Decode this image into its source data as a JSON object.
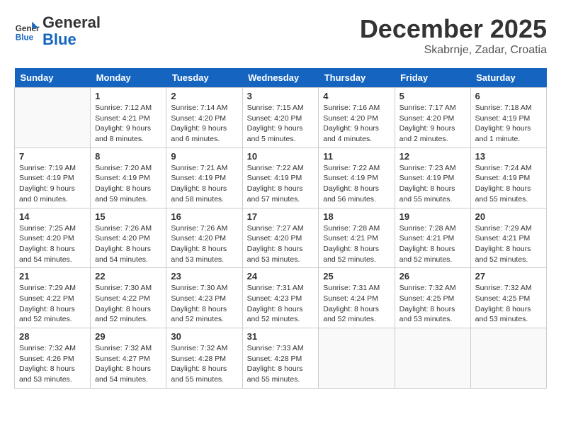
{
  "header": {
    "logo_general": "General",
    "logo_blue": "Blue",
    "month": "December 2025",
    "location": "Skabrnje, Zadar, Croatia"
  },
  "days_of_week": [
    "Sunday",
    "Monday",
    "Tuesday",
    "Wednesday",
    "Thursday",
    "Friday",
    "Saturday"
  ],
  "weeks": [
    [
      {
        "day": null
      },
      {
        "day": "1",
        "sunrise": "7:12 AM",
        "sunset": "4:21 PM",
        "daylight": "9 hours and 8 minutes."
      },
      {
        "day": "2",
        "sunrise": "7:14 AM",
        "sunset": "4:20 PM",
        "daylight": "9 hours and 6 minutes."
      },
      {
        "day": "3",
        "sunrise": "7:15 AM",
        "sunset": "4:20 PM",
        "daylight": "9 hours and 5 minutes."
      },
      {
        "day": "4",
        "sunrise": "7:16 AM",
        "sunset": "4:20 PM",
        "daylight": "9 hours and 4 minutes."
      },
      {
        "day": "5",
        "sunrise": "7:17 AM",
        "sunset": "4:20 PM",
        "daylight": "9 hours and 2 minutes."
      },
      {
        "day": "6",
        "sunrise": "7:18 AM",
        "sunset": "4:19 PM",
        "daylight": "9 hours and 1 minute."
      }
    ],
    [
      {
        "day": "7",
        "sunrise": "7:19 AM",
        "sunset": "4:19 PM",
        "daylight": "9 hours and 0 minutes."
      },
      {
        "day": "8",
        "sunrise": "7:20 AM",
        "sunset": "4:19 PM",
        "daylight": "8 hours and 59 minutes."
      },
      {
        "day": "9",
        "sunrise": "7:21 AM",
        "sunset": "4:19 PM",
        "daylight": "8 hours and 58 minutes."
      },
      {
        "day": "10",
        "sunrise": "7:22 AM",
        "sunset": "4:19 PM",
        "daylight": "8 hours and 57 minutes."
      },
      {
        "day": "11",
        "sunrise": "7:22 AM",
        "sunset": "4:19 PM",
        "daylight": "8 hours and 56 minutes."
      },
      {
        "day": "12",
        "sunrise": "7:23 AM",
        "sunset": "4:19 PM",
        "daylight": "8 hours and 55 minutes."
      },
      {
        "day": "13",
        "sunrise": "7:24 AM",
        "sunset": "4:19 PM",
        "daylight": "8 hours and 55 minutes."
      }
    ],
    [
      {
        "day": "14",
        "sunrise": "7:25 AM",
        "sunset": "4:20 PM",
        "daylight": "8 hours and 54 minutes."
      },
      {
        "day": "15",
        "sunrise": "7:26 AM",
        "sunset": "4:20 PM",
        "daylight": "8 hours and 54 minutes."
      },
      {
        "day": "16",
        "sunrise": "7:26 AM",
        "sunset": "4:20 PM",
        "daylight": "8 hours and 53 minutes."
      },
      {
        "day": "17",
        "sunrise": "7:27 AM",
        "sunset": "4:20 PM",
        "daylight": "8 hours and 53 minutes."
      },
      {
        "day": "18",
        "sunrise": "7:28 AM",
        "sunset": "4:21 PM",
        "daylight": "8 hours and 52 minutes."
      },
      {
        "day": "19",
        "sunrise": "7:28 AM",
        "sunset": "4:21 PM",
        "daylight": "8 hours and 52 minutes."
      },
      {
        "day": "20",
        "sunrise": "7:29 AM",
        "sunset": "4:21 PM",
        "daylight": "8 hours and 52 minutes."
      }
    ],
    [
      {
        "day": "21",
        "sunrise": "7:29 AM",
        "sunset": "4:22 PM",
        "daylight": "8 hours and 52 minutes."
      },
      {
        "day": "22",
        "sunrise": "7:30 AM",
        "sunset": "4:22 PM",
        "daylight": "8 hours and 52 minutes."
      },
      {
        "day": "23",
        "sunrise": "7:30 AM",
        "sunset": "4:23 PM",
        "daylight": "8 hours and 52 minutes."
      },
      {
        "day": "24",
        "sunrise": "7:31 AM",
        "sunset": "4:23 PM",
        "daylight": "8 hours and 52 minutes."
      },
      {
        "day": "25",
        "sunrise": "7:31 AM",
        "sunset": "4:24 PM",
        "daylight": "8 hours and 52 minutes."
      },
      {
        "day": "26",
        "sunrise": "7:32 AM",
        "sunset": "4:25 PM",
        "daylight": "8 hours and 53 minutes."
      },
      {
        "day": "27",
        "sunrise": "7:32 AM",
        "sunset": "4:25 PM",
        "daylight": "8 hours and 53 minutes."
      }
    ],
    [
      {
        "day": "28",
        "sunrise": "7:32 AM",
        "sunset": "4:26 PM",
        "daylight": "8 hours and 53 minutes."
      },
      {
        "day": "29",
        "sunrise": "7:32 AM",
        "sunset": "4:27 PM",
        "daylight": "8 hours and 54 minutes."
      },
      {
        "day": "30",
        "sunrise": "7:32 AM",
        "sunset": "4:28 PM",
        "daylight": "8 hours and 55 minutes."
      },
      {
        "day": "31",
        "sunrise": "7:33 AM",
        "sunset": "4:28 PM",
        "daylight": "8 hours and 55 minutes."
      },
      {
        "day": null
      },
      {
        "day": null
      },
      {
        "day": null
      }
    ]
  ]
}
